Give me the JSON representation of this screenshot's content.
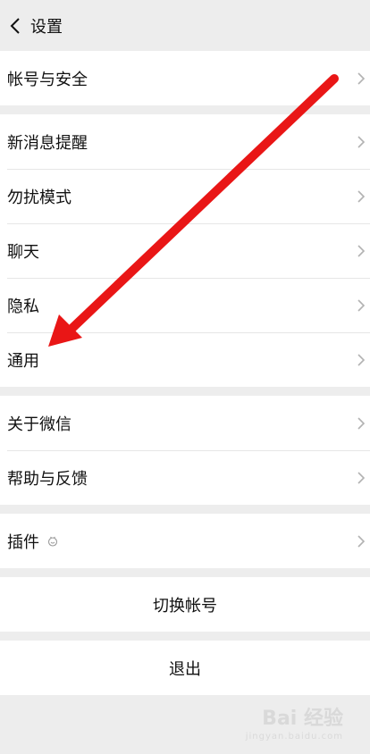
{
  "header": {
    "title": "设置",
    "back_icon": "chevron-left-icon"
  },
  "groups": [
    {
      "items": [
        {
          "label": "帐号与安全"
        }
      ]
    },
    {
      "items": [
        {
          "label": "新消息提醒"
        },
        {
          "label": "勿扰模式"
        },
        {
          "label": "聊天"
        },
        {
          "label": "隐私"
        },
        {
          "label": "通用"
        }
      ]
    },
    {
      "items": [
        {
          "label": "关于微信"
        },
        {
          "label": "帮助与反馈"
        }
      ]
    },
    {
      "items": [
        {
          "label": "插件",
          "icon": "plugin-icon"
        }
      ]
    }
  ],
  "actions": {
    "switch_account": "切换帐号",
    "logout": "退出"
  },
  "annotation": {
    "arrow_color": "#e91616"
  },
  "watermark": {
    "brand": "Bai 经验",
    "url": "jingyan.baidu.com"
  }
}
